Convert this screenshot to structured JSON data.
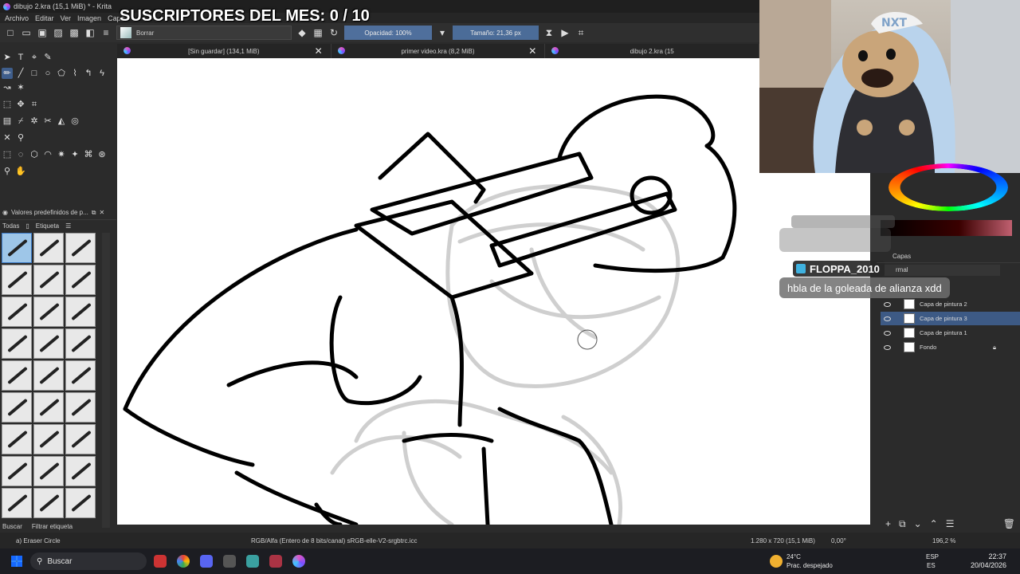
{
  "window": {
    "title": "dibujo 2.kra (15,1 MiB) * - Krita"
  },
  "menu": [
    "Archivo",
    "Editar",
    "Ver",
    "Imagen",
    "Capa"
  ],
  "overlay": {
    "subscribers": "SUSCRIPTORES DEL MES: 0 / 10"
  },
  "toolbar": {
    "brush_name": "Borrar",
    "opacity": "Opacidad: 100%",
    "size": "Tamaño: 21,36 px"
  },
  "tabs": [
    {
      "label": "[Sin guardar]  (134,1 MiB)"
    },
    {
      "label": "primer video.kra (8,2 MiB)"
    },
    {
      "label": "dibujo 2.kra (15"
    }
  ],
  "presets": {
    "title": "Valores predefinidos de p...",
    "filter": "Todas",
    "tag": "Etiqueta",
    "search_placeholder": "Buscar",
    "filter_tag": "Filtrar etiqueta"
  },
  "chat": {
    "user": "FLOPPA_2010",
    "message": "hbla de la goleada de alianza xdd",
    "ghost": "FLOPPA_2010"
  },
  "layers": {
    "title": "Capas",
    "mode": "rmal",
    "items": [
      "Capa de pintura 2",
      "Capa de pintura 3",
      "Capa de pintura 1",
      "Fondo"
    ]
  },
  "status": {
    "tool": "a) Eraser Circle",
    "colorspace": "RGB/Alfa (Entero de 8 bits/canal)  sRGB-elle-V2-srgbtrc.icc",
    "dimensions": "1.280 x 720 (15,1 MiB)",
    "rotation": "0,00°",
    "zoom": "196,2 %"
  },
  "taskbar": {
    "search": "Buscar",
    "weather_temp": "24°C",
    "weather_desc": "Prac. despejado",
    "lang1": "ESP",
    "lang2": "ES",
    "time": "22:37",
    "date": "20/04/2026"
  },
  "colors": {
    "accent": "#3d5a85",
    "canvas": "#ffffff",
    "bg": "#2b2b2b"
  }
}
